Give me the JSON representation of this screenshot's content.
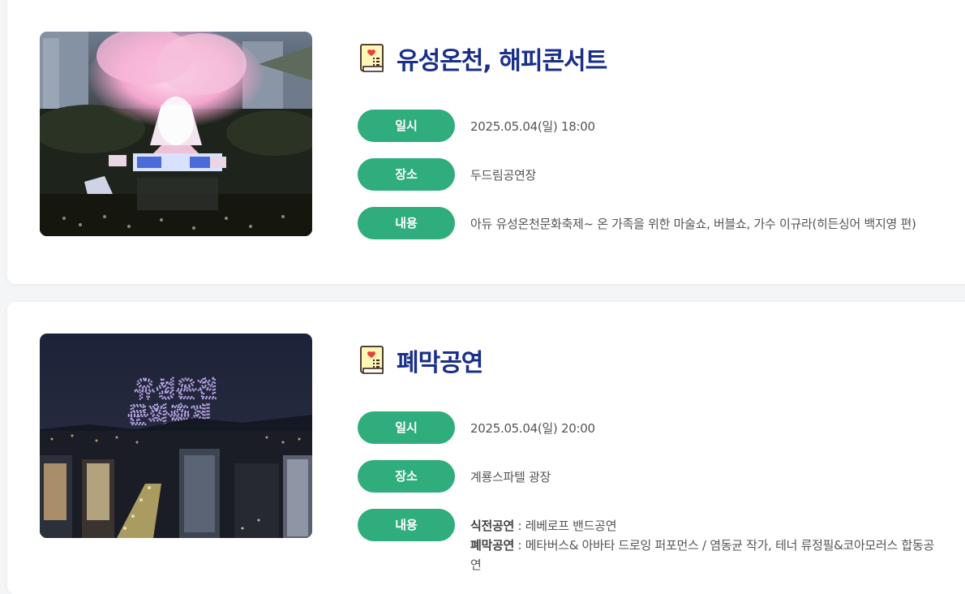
{
  "events": [
    {
      "title": "유성온천, 해피콘서트",
      "date_label": "일시",
      "date": "2025.05.04(일) 18:00",
      "place_label": "장소",
      "place": "두드림공연장",
      "content_label": "내용",
      "content": "아듀 유성온천문화축제~ 온 가족을 위한 마술쇼, 버블쇼, 가수 이규라(히든싱어 백지영 편)"
    },
    {
      "title": "폐막공연",
      "date_label": "일시",
      "date": "2025.05.04(일) 20:00",
      "place_label": "장소",
      "place": "계룡스파텔 광장",
      "content_label": "내용",
      "content_lines": [
        {
          "label": "식전공연",
          "sep": " : ",
          "text": "레베로프 밴드공연"
        },
        {
          "label": "폐막공연",
          "sep": " : ",
          "text": "메타버스& 아바타 드로잉 퍼포먼스 / 염동균 작가, 테너 류정필&코아모러스 합동공연"
        }
      ],
      "drone_text": [
        "유성온천",
        "문화축제"
      ]
    }
  ],
  "colors": {
    "title": "#1a2f8a",
    "pill": "#2fad7c",
    "card": "#ffffff",
    "page": "#f3f5f7"
  },
  "icons": {
    "title_icon": "book-heart-icon"
  }
}
